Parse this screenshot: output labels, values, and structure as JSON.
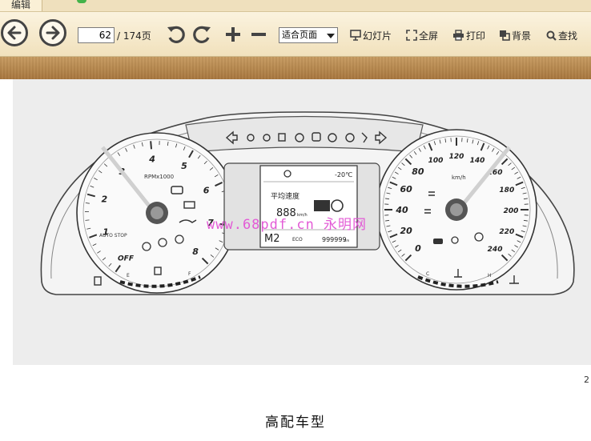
{
  "tab": {
    "label": "编辑"
  },
  "toolbar": {
    "current_page": "62",
    "total_pages": "/ 174页",
    "zoom": "适合页面",
    "slideshow": "幻灯片",
    "fullscreen": "全屏",
    "print": "打印",
    "background": "背景",
    "search": "查找"
  },
  "cluster": {
    "rpm_unit": "RPMx1000",
    "rpm_ticks": [
      "OFF",
      "1",
      "2",
      "3",
      "4",
      "5",
      "6",
      "7",
      "8"
    ],
    "auto_stop": "AUTO STOP",
    "speed_unit": "km/h",
    "speed_ticks": [
      "0",
      "20",
      "40",
      "60",
      "80",
      "100",
      "120",
      "140",
      "160",
      "180",
      "200",
      "220",
      "240"
    ],
    "display_temp": "-20℃",
    "display_title": "平均速度",
    "display_value": "888",
    "display_value_unit": "km/h",
    "display_gear": "M2",
    "display_eco": "ECO",
    "display_odo": "999999",
    "display_odo_unit": "km",
    "fuel_e": "E",
    "fuel_f": "F",
    "temp_c": "C",
    "temp_h": "H"
  },
  "watermark": "www.68pdf.cn 永明网",
  "page_number": "2",
  "caption": "高配车型"
}
